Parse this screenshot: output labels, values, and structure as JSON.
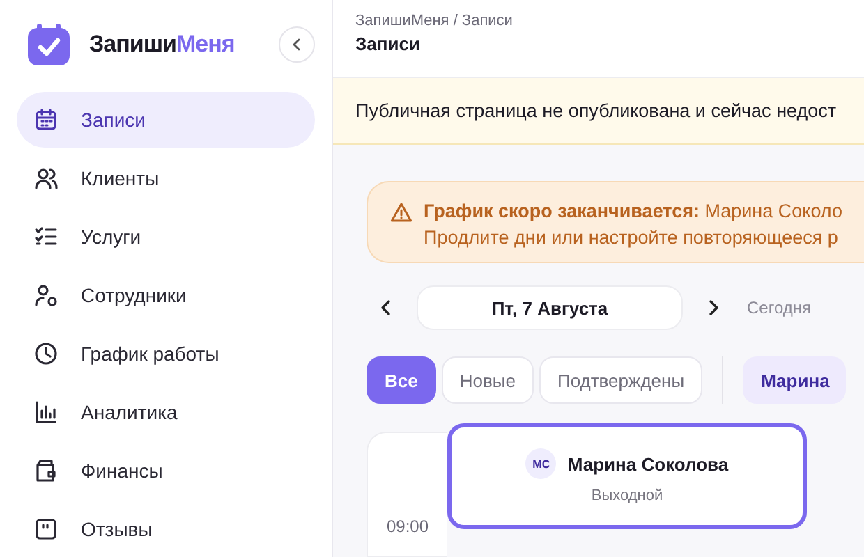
{
  "sidebar": {
    "logo": {
      "part1": "Запиши",
      "part2": "Меня"
    },
    "items": [
      {
        "label": "Записи",
        "selected": true
      },
      {
        "label": "Клиенты",
        "selected": false
      },
      {
        "label": "Услуги",
        "selected": false
      },
      {
        "label": "Сотрудники",
        "selected": false
      },
      {
        "label": "График работы",
        "selected": false
      },
      {
        "label": "Аналитика",
        "selected": false
      },
      {
        "label": "Финансы",
        "selected": false
      },
      {
        "label": "Отзывы",
        "selected": false
      }
    ]
  },
  "header": {
    "breadcrumb": "ЗапишиМеня / Записи",
    "title": "Записи"
  },
  "notice": "Публичная страница не опубликована и сейчас недост",
  "alert": {
    "line1": "**График скоро заканчивается:** Марина Соколо",
    "line2": "Продлите дни или настройте повторяющееся р"
  },
  "date_nav": {
    "date": "Пт, 7 Августа",
    "today": "Сегодня"
  },
  "filters": [
    {
      "label": "Все",
      "selected": true
    },
    {
      "label": "Новые",
      "selected": false
    },
    {
      "label": "Подтверждены",
      "selected": false
    }
  ],
  "staff_chip": "Марина",
  "calendar": {
    "column": {
      "initials": "МС",
      "name": "Марина Соколова",
      "status": "Выходной",
      "selected": true
    },
    "times": [
      "09:00"
    ]
  }
}
